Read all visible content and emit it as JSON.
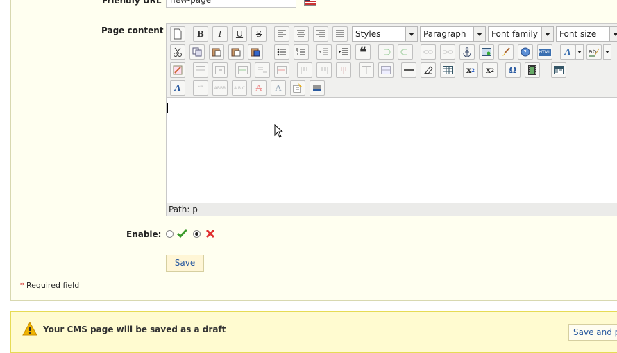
{
  "form": {
    "friendly_url_label": "Friendly URL",
    "friendly_url_value": "new-page",
    "page_content_label": "Page content",
    "enable_label": "Enable:",
    "save_label": "Save",
    "required_star": "*",
    "required_text": "Required field"
  },
  "editor": {
    "styles_dropdown": "Styles",
    "format_dropdown": "Paragraph",
    "font_family_dropdown": "Font family",
    "font_size_dropdown": "Font size",
    "path_label": "Path: p",
    "bold": "B",
    "italic": "I",
    "underline": "U",
    "strike": "S",
    "subscript": "x",
    "superscript": "x",
    "omega": "Ω",
    "quote": "❝",
    "html": "HTML",
    "sub_mark": "2",
    "sup_mark": "2"
  },
  "enable": {
    "yes_selected": false,
    "no_selected": true
  },
  "draft": {
    "message": "Your CMS page will be saved as a draft",
    "save_preview_label": "Save and preview"
  },
  "colors": {
    "panel_bg": "#fffff0",
    "link_blue": "#2a5aa0",
    "warning_bg": "#fffbd0",
    "check_green": "#3a9a2a",
    "cross_red": "#e03030"
  }
}
